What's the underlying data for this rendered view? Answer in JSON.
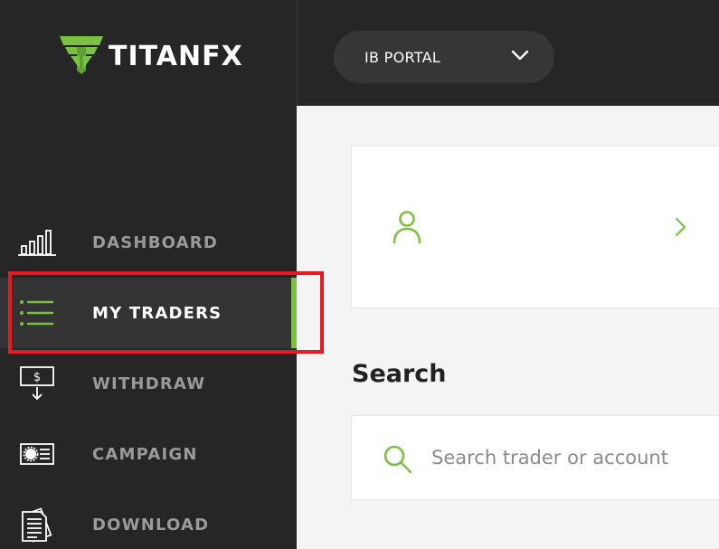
{
  "brand": {
    "name_main": "TITAN",
    "name_suffix": "FX",
    "accent_color": "#7ac143"
  },
  "sidebar": {
    "items": [
      {
        "label": "DASHBOARD",
        "icon": "bar-chart-icon",
        "active": false
      },
      {
        "label": "MY TRADERS",
        "icon": "list-icon",
        "active": true
      },
      {
        "label": "WITHDRAW",
        "icon": "withdraw-icon",
        "active": false
      },
      {
        "label": "CAMPAIGN",
        "icon": "campaign-icon",
        "active": false
      },
      {
        "label": "DOWNLOAD",
        "icon": "document-icon",
        "active": false
      }
    ]
  },
  "header": {
    "portal_select": {
      "value": "IB PORTAL",
      "icon": "chevron-down-icon"
    }
  },
  "main": {
    "user_card": {
      "icon": "user-icon",
      "chevron_icon": "chevron-right-icon"
    },
    "search": {
      "heading": "Search",
      "placeholder": "Search trader or account",
      "icon": "search-icon"
    }
  }
}
